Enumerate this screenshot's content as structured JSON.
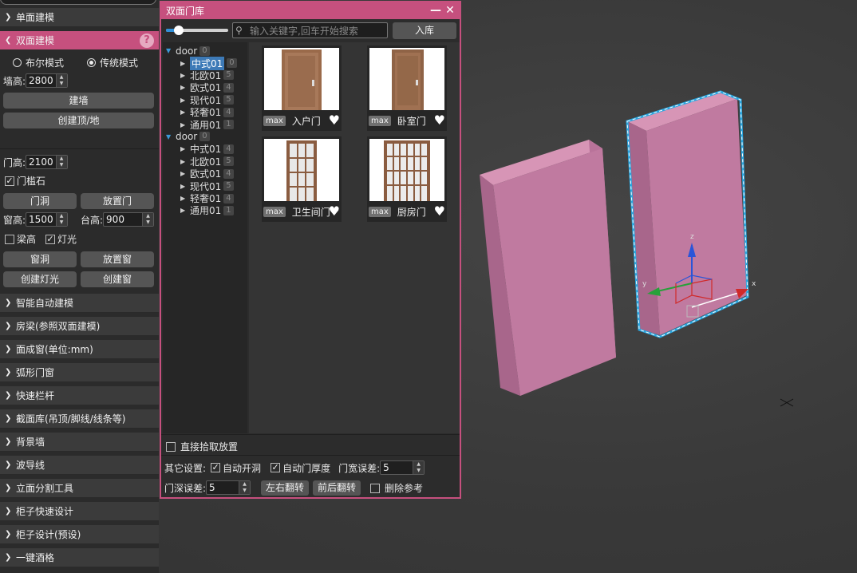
{
  "colors": {
    "accent": "#c6507e",
    "panel_bg": "#2b2b2b",
    "selection_blue": "#3d7ab7",
    "object_pink": "#c27ba0",
    "highlight_cyan": "#2aa7e0"
  },
  "side_panel": {
    "categories_top": [
      {
        "label": "单面建模"
      },
      {
        "label": "双面建模",
        "active": true
      }
    ],
    "help_icon": "?",
    "mode": {
      "bool_label": "布尔模式",
      "classic_label": "传统模式",
      "selected": "classic"
    },
    "wall_height": {
      "label": "墙高:",
      "value": "2800"
    },
    "build_wall_label": "建墙",
    "create_ceiling_label": "创建顶/地",
    "door_height": {
      "label": "门高:",
      "value": "2100"
    },
    "threshold_label": "门槛石",
    "door_hole_label": "门洞",
    "place_door_label": "放置门",
    "window_height": {
      "label": "窗高:",
      "value": "1500"
    },
    "sill_height": {
      "label": "台高:",
      "value": "900"
    },
    "beam_label": "梁高",
    "light_label": "灯光",
    "window_hole_label": "窗洞",
    "place_window_label": "放置窗",
    "create_light_label": "创建灯光",
    "create_window_label": "创建窗",
    "categories_bottom": [
      "智能自动建模",
      "房梁(参照双面建模)",
      "面成窗(单位:mm)",
      "弧形门窗",
      "快速栏杆",
      "截面库(吊顶/脚线/线条等)",
      "背景墙",
      "波导线",
      "立面分割工具",
      "柜子快速设计",
      "柜子设计(预设)",
      "一键酒格"
    ]
  },
  "dialog": {
    "title": "双面门库",
    "minimize_icon": "—",
    "close_icon": "✕",
    "search_placeholder": "输入关键字,回车开始搜索",
    "import_label": "入库",
    "tree": [
      {
        "label": "door",
        "count": "0",
        "children": [
          {
            "label": "中式01",
            "count": "0",
            "selected": true
          },
          {
            "label": "北欧01",
            "count": "5"
          },
          {
            "label": "欧式01",
            "count": "4"
          },
          {
            "label": "现代01",
            "count": "5"
          },
          {
            "label": "轻奢01",
            "count": "4"
          },
          {
            "label": "通用01",
            "count": "1"
          }
        ]
      },
      {
        "label": "door",
        "count": "0",
        "children": [
          {
            "label": "中式01",
            "count": "4"
          },
          {
            "label": "北欧01",
            "count": "5"
          },
          {
            "label": "欧式01",
            "count": "4"
          },
          {
            "label": "现代01",
            "count": "5"
          },
          {
            "label": "轻奢01",
            "count": "4"
          },
          {
            "label": "通用01",
            "count": "1"
          }
        ]
      }
    ],
    "items": [
      {
        "tag": "max",
        "name": "入户门"
      },
      {
        "tag": "max",
        "name": "卧室门"
      },
      {
        "tag": "max",
        "name": "卫生间门"
      },
      {
        "tag": "max",
        "name": "厨房门"
      }
    ],
    "direct_pick_label": "直接拾取放置",
    "other_settings_label": "其它设置:",
    "auto_hole_label": "自动开洞",
    "auto_thickness_label": "自动门厚度",
    "width_tolerance": {
      "label": "门宽误差:",
      "value": "5"
    },
    "depth_tolerance": {
      "label": "门深误差:",
      "value": "5"
    },
    "flip_lr_label": "左右翻转",
    "flip_fb_label": "前后翻转",
    "delete_ref_label": "删除参考"
  },
  "viewport": {
    "axis_x": "x",
    "axis_y": "y",
    "axis_z": "z"
  }
}
